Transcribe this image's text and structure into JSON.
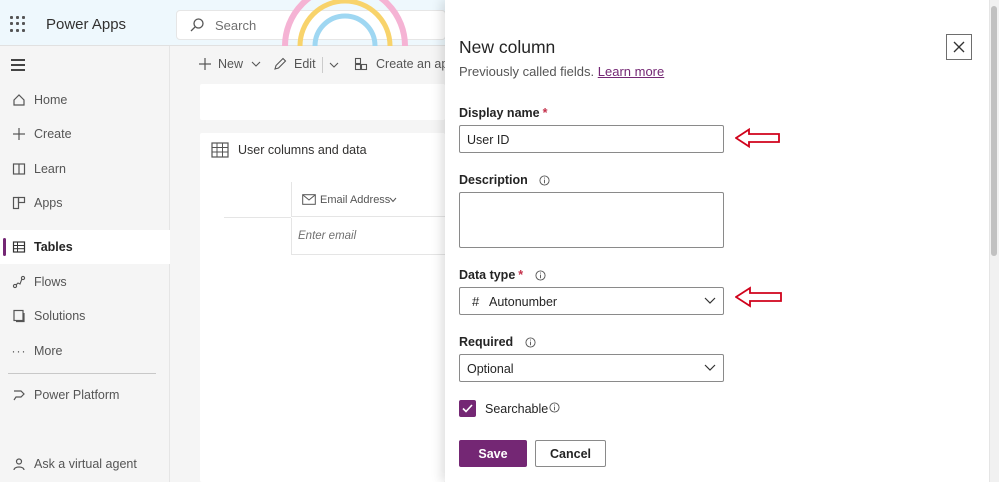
{
  "app": {
    "name": "Power Apps"
  },
  "search": {
    "placeholder": "Search"
  },
  "sidebar": {
    "items": [
      {
        "label": "Home",
        "icon": "home-icon"
      },
      {
        "label": "Create",
        "icon": "plus-icon"
      },
      {
        "label": "Learn",
        "icon": "book-icon"
      },
      {
        "label": "Apps",
        "icon": "apps-icon"
      },
      {
        "label": "Tables",
        "icon": "table-icon",
        "active": true
      },
      {
        "label": "Flows",
        "icon": "flow-icon"
      },
      {
        "label": "Solutions",
        "icon": "solutions-icon"
      },
      {
        "label": "More",
        "icon": "more-icon"
      },
      {
        "label": "Power Platform",
        "icon": "power-platform-icon"
      },
      {
        "label": "Ask a virtual agent",
        "icon": "agent-icon"
      }
    ]
  },
  "commandbar": {
    "new_label": "New",
    "edit_label": "Edit",
    "create_app_label": "Create an app"
  },
  "table_card": {
    "title": "User columns and data",
    "column_header": "Email Address",
    "cell_placeholder": "Enter email"
  },
  "panel": {
    "title": "New column",
    "subtitle": "Previously called fields.",
    "learn_more": "Learn more",
    "display_name": {
      "label": "Display name",
      "required": "*",
      "value": "User ID"
    },
    "description": {
      "label": "Description",
      "value": ""
    },
    "data_type": {
      "label": "Data type",
      "required": "*",
      "value": "Autonumber",
      "prefix": "#"
    },
    "required_field": {
      "label": "Required",
      "value": "Optional"
    },
    "searchable": {
      "label": "Searchable",
      "checked": true
    },
    "save_label": "Save",
    "cancel_label": "Cancel"
  },
  "colors": {
    "accent": "#742774",
    "annotation_arrow": "#d0021b",
    "topbar": "#eef8fd"
  }
}
